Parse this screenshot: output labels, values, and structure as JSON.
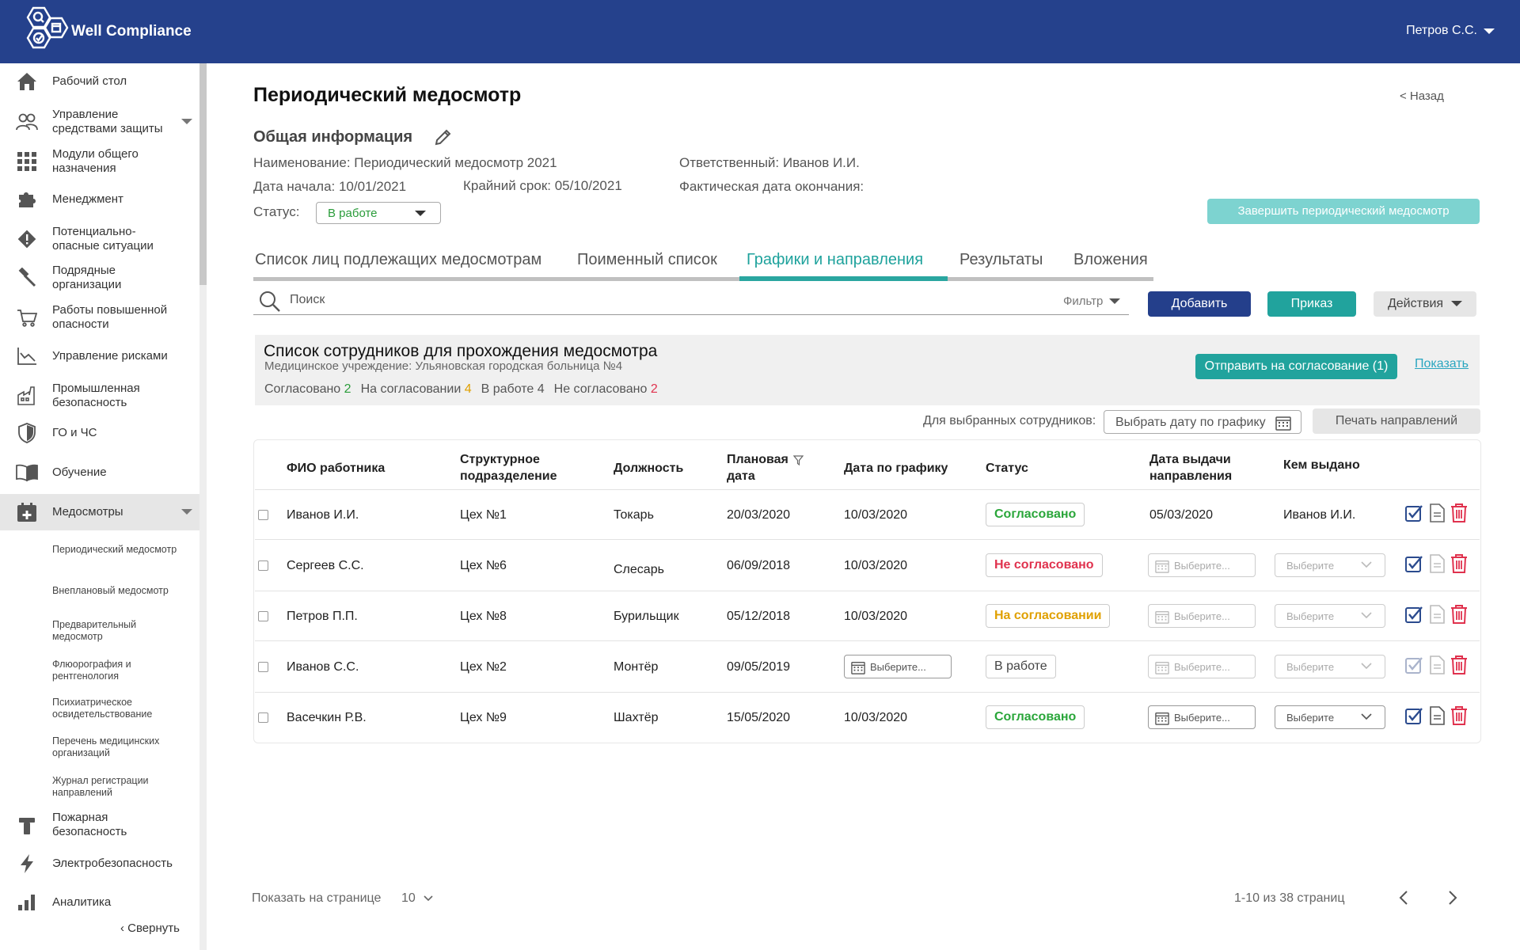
{
  "header": {
    "brand": "Well Compliance",
    "user": "Петров С.С."
  },
  "sidebar": {
    "items": [
      {
        "label": "Рабочий стол",
        "icon": "home-icon"
      },
      {
        "label": "Управление средствами защиты",
        "icon": "users-icon"
      },
      {
        "label": "Модули общего назначения",
        "icon": "grid-icon"
      },
      {
        "label": "Менеджмент",
        "icon": "puzzle-icon"
      },
      {
        "label": "Потенциально-опасные ситуации",
        "icon": "warning-icon"
      },
      {
        "label": "Подрядные организации",
        "icon": "hammer-icon"
      },
      {
        "label": "Работы повышенной опасности",
        "icon": "cart-icon"
      },
      {
        "label": "Управление рисками",
        "icon": "chart-line-icon"
      },
      {
        "label": "Промышленная безопасность",
        "icon": "factory-icon"
      },
      {
        "label": "ГО и ЧС",
        "icon": "shield-icon"
      },
      {
        "label": "Обучение",
        "icon": "book-icon"
      },
      {
        "label": "Медосмотры",
        "icon": "medical-calendar-icon"
      },
      {
        "label": "Пожарная безопасность",
        "icon": "fire-extinguisher-icon"
      },
      {
        "label": "Электробезопасность",
        "icon": "lightning-icon"
      },
      {
        "label": "Аналитика",
        "icon": "bar-chart-icon"
      }
    ],
    "subitems": [
      "Периодический медосмотр",
      "Внеплановый медосмотр",
      "Предварительный медосмотр",
      "Флюорография и рентгенология",
      "Психиатрическое освидетельствование",
      "Перечень медицинских организаций",
      "Журнал регистрации направлений"
    ],
    "collapse": "‹ Свернуть"
  },
  "page": {
    "title": "Периодический медосмотр",
    "back": "<   Назад",
    "section_title": "Общая информация",
    "name": "Наименование: Периодический медосмотр 2021",
    "responsible": "Ответственный: Иванов И.И.",
    "start_date": "Дата начала: 10/01/2021",
    "deadline": "Крайний срок: 05/10/2021",
    "actual_end": "Фактическая дата окончания:",
    "status_label": "Статус:",
    "status_value": "В работе",
    "finish_button": "Завершить периодический медосмотр"
  },
  "tabs": [
    {
      "label": "Список лиц подлежащих медосмотрам"
    },
    {
      "label": "Поименный список"
    },
    {
      "label": "Графики и направления"
    },
    {
      "label": "Результаты"
    },
    {
      "label": "Вложения"
    }
  ],
  "toolbar": {
    "search_placeholder": "Поиск",
    "filter": "Фильтр",
    "add": "Добавить",
    "order": "Приказ",
    "actions": "Действия"
  },
  "panel": {
    "title": "Список сотрудников для прохождения медосмотра",
    "subtitle": "Медицинское учреждение: Ульяновская городская больница №4",
    "stats": {
      "approved_label": "Согласовано",
      "approved": "2",
      "pending_label": "На согласовании",
      "pending": "4",
      "in_work_label": "В работе",
      "in_work": "4",
      "rejected_label": "Не согласовано",
      "rejected": "2"
    },
    "send_button": "Отправить на согласование (1)",
    "show_link": "Показать"
  },
  "selected": {
    "label": "Для выбранных сотрудников:",
    "pick_date": "Выбрать дату по графику",
    "print": "Печать направлений"
  },
  "table": {
    "headers": {
      "name": "ФИО работника",
      "dept": "Структурное подразделение",
      "position": "Должность",
      "planned": "Плановая дата",
      "scheduled": "Дата по графику",
      "status": "Статус",
      "issue_date": "Дата выдачи направления",
      "issued_by": "Кем выдано"
    },
    "placeholder_date": "Выберите...",
    "placeholder_select": "Выберите",
    "rows": [
      {
        "name": "Иванов И.И.",
        "dept": "Цех №1",
        "position": "Токарь",
        "planned": "20/03/2020",
        "scheduled": "10/03/2020",
        "status": "Согласовано",
        "issue_date": "05/03/2020",
        "issued_by": "Иванов И.И."
      },
      {
        "name": "Сергеев С.С.",
        "dept": "Цех №6",
        "position": "Слесарь",
        "planned": "06/09/2018",
        "scheduled": "10/03/2020",
        "status": "Не согласовано"
      },
      {
        "name": "Петров П.П.",
        "dept": "Цех №8",
        "position": "Бурильщик",
        "planned": "05/12/2018",
        "scheduled": "10/03/2020",
        "status": "На согласовании"
      },
      {
        "name": "Иванов С.С.",
        "dept": "Цех №2",
        "position": "Монтёр",
        "planned": "09/05/2019",
        "status": "В работе"
      },
      {
        "name": "Васечкин Р.В.",
        "dept": "Цех №9",
        "position": "Шахтёр",
        "planned": "15/05/2020",
        "scheduled": "10/03/2020",
        "status": "Согласовано"
      }
    ]
  },
  "pagination": {
    "per_page_label": "Показать на странице",
    "per_page": "10",
    "pages": "1-10 из 38 страниц"
  },
  "colors": {
    "header": "#25418c",
    "accent": "#21a39d",
    "approved": "#2aa63a",
    "rejected": "#e0324e",
    "pending": "#e0a000"
  }
}
